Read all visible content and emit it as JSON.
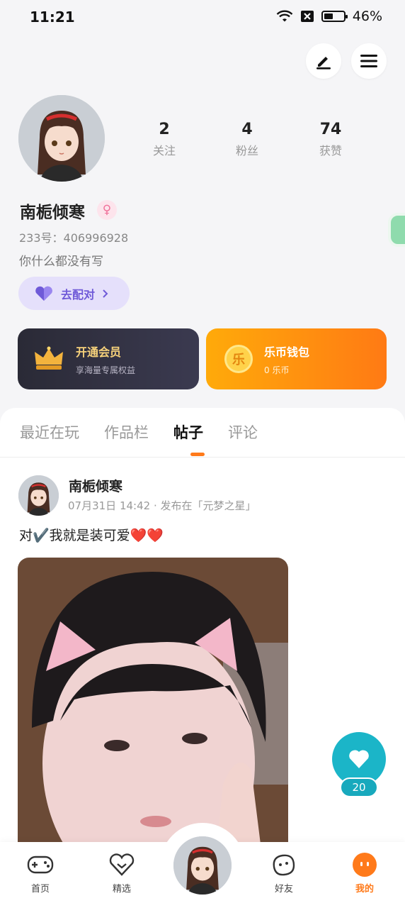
{
  "status": {
    "time": "11:21",
    "battery": "46%",
    "battery_level": 0.46
  },
  "profile": {
    "name": "南栀倾寒",
    "uid": "233号：406996928",
    "bio": "你什么都没有写",
    "pair_label": "去配对",
    "stats": [
      {
        "value": "2",
        "label": "关注"
      },
      {
        "value": "4",
        "label": "粉丝"
      },
      {
        "value": "74",
        "label": "获赞"
      }
    ]
  },
  "cards": {
    "vip": {
      "title": "开通会员",
      "subtitle": "享海量专属权益"
    },
    "wallet": {
      "title": "乐币钱包",
      "subtitle": "0 乐币",
      "coin_char": "乐"
    }
  },
  "tabs": [
    "最近在玩",
    "作品栏",
    "帖子",
    "评论"
  ],
  "post": {
    "author": "南栀倾寒",
    "meta": "07月31日 14:42 · 发布在「元梦之星」",
    "text": "对✔️我就是装可爱❤️❤️",
    "likes": "20"
  },
  "nav": {
    "items": [
      {
        "label": "首页"
      },
      {
        "label": "精选"
      },
      {
        "label": "好友"
      },
      {
        "label": "我的"
      }
    ]
  },
  "colors": {
    "accent": "#ff7a1a",
    "teal": "#1bb5c8",
    "purple": "#6f5ad8"
  },
  "icons": [
    "wifi-icon",
    "sim-icon",
    "battery-icon",
    "edit-icon",
    "menu-icon",
    "gender-female-icon",
    "heart-icon",
    "chevron-right-icon",
    "crown-icon",
    "coin-icon",
    "gamepad-icon",
    "featured-icon",
    "friends-icon",
    "me-icon"
  ]
}
